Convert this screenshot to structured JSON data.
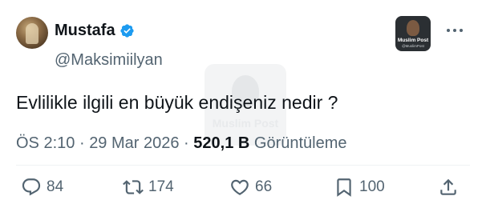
{
  "author": {
    "display_name": "Mustafa",
    "handle": "@Maksimiilyan",
    "verified": true
  },
  "brand_badge": {
    "name": "Muslim Post",
    "sub": "@MuslimPost"
  },
  "tweet": {
    "text": "Evlilikle ilgili en büyük endişeniz nedir ?"
  },
  "meta": {
    "time": "ÖS 2:10",
    "date": "29 Mar 2026",
    "separator": "·",
    "views_count": "520,1 B",
    "views_label": "Görüntüleme"
  },
  "actions": {
    "replies": "84",
    "reposts": "174",
    "likes": "66",
    "bookmarks": "100"
  },
  "colors": {
    "text": "#0f1419",
    "secondary": "#536471",
    "verified": "#1d9bf0",
    "divider": "#eff3f4"
  },
  "icons": [
    "verified-icon",
    "more-icon",
    "reply-icon",
    "repost-icon",
    "like-icon",
    "bookmark-icon",
    "share-icon"
  ]
}
